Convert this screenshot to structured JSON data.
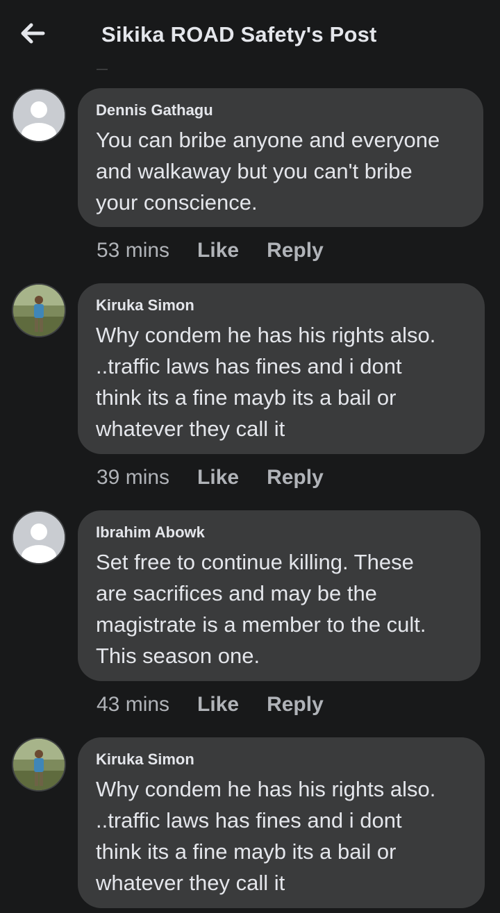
{
  "header": {
    "title": "Sikika ROAD Safety's Post",
    "back_icon": "arrow-left-icon"
  },
  "comments": [
    {
      "author": "Dennis Gathagu",
      "text": "You can bribe anyone and everyone\nand walkaway but you can't bribe\nyour conscience.",
      "time": "53 mins",
      "like_label": "Like",
      "reply_label": "Reply",
      "avatar": "default-avatar-icon"
    },
    {
      "author": "Kiruka Simon",
      "text": "Why condem he has his rights also.\n..traffic laws has fines and i dont\nthink its a fine mayb its a bail or\nwhatever they call it",
      "time": "39 mins",
      "like_label": "Like",
      "reply_label": "Reply",
      "avatar": "profile-photo"
    },
    {
      "author": "Ibrahim Abowk",
      "text": "Set free to continue killing. These\nare sacrifices and may be the\nmagistrate is a member to the cult.\nThis season one.",
      "time": "43 mins",
      "like_label": "Like",
      "reply_label": "Reply",
      "avatar": "default-avatar-icon"
    },
    {
      "author": "Kiruka Simon",
      "text": "Why condem he has his rights also.\n..traffic laws has fines and i dont\nthink its a fine mayb its a bail or\nwhatever they call it",
      "avatar": "profile-photo"
    }
  ],
  "colors": {
    "background": "#18191a",
    "bubble": "#3a3b3c",
    "primary_text": "#e4e6eb",
    "secondary_text": "#b0b3b8"
  }
}
